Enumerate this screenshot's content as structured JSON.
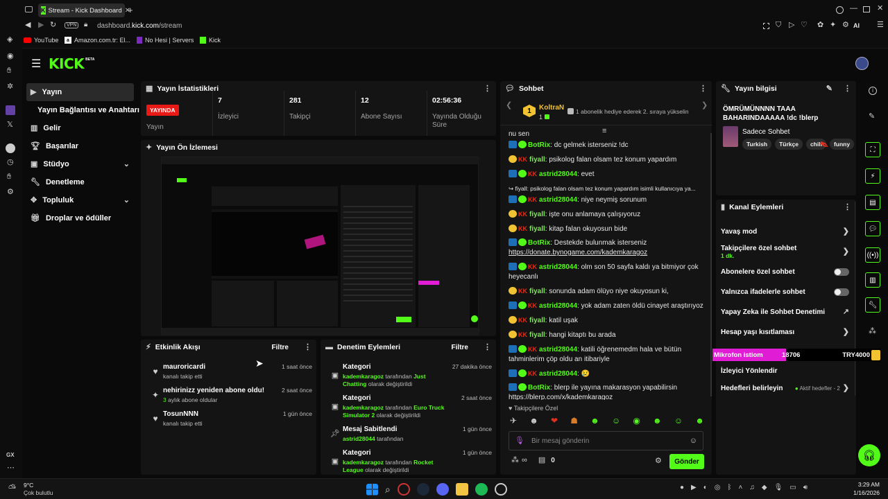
{
  "browser": {
    "tab_title": "Stream - Kick Dashboard",
    "url_prefix": "dashboard.",
    "url_domain": "kick.com",
    "url_path": "/stream",
    "vpn": "VPN",
    "ai": "AI",
    "bookmarks": [
      "YouTube",
      "Amazon.com.tr: El...",
      "No Hesi | Servers",
      "Kick"
    ],
    "gx": "GX"
  },
  "logo": {
    "text": "KICK",
    "beta": "BETA"
  },
  "nav": {
    "items": [
      {
        "label": "Yayın"
      },
      {
        "label": "Yayın Bağlantısı ve Anahtarı"
      },
      {
        "label": "Gelir"
      },
      {
        "label": "Başarılar"
      },
      {
        "label": "Stüdyo"
      },
      {
        "label": "Denetleme"
      },
      {
        "label": "Topluluk"
      },
      {
        "label": "Droplar ve ödüller"
      }
    ]
  },
  "stats": {
    "title": "Yayın İstatistikleri",
    "live_label": "YAYINDA",
    "live_sub": "Yayın",
    "viewers": {
      "value": "7",
      "label": "İzleyici"
    },
    "followers": {
      "value": "281",
      "label": "Takipçi"
    },
    "subs": {
      "value": "12",
      "label": "Abone Sayısı"
    },
    "uptime": {
      "value": "02:56:36",
      "label": "Yayında Olduğu Süre"
    }
  },
  "preview": {
    "title": "Yayın Ön İzlemesi"
  },
  "activity": {
    "title": "Etkinlik Akışı",
    "filter": "Filtre",
    "items": [
      {
        "title": "mauroricardi",
        "sub": "kanalı takip etti",
        "time": "1 saat önce"
      },
      {
        "title": "nehirinizz yeniden abone oldu!",
        "sub_highlight": "3",
        "sub": " aylık abone oldular",
        "time": "2 saat önce"
      },
      {
        "title": "TosunNNN",
        "sub": "kanalı takip etti",
        "time": "1 gün önce"
      }
    ]
  },
  "moderation": {
    "title": "Denetim Eylemleri",
    "filter": "Filtre",
    "items": [
      {
        "title": "Kategori",
        "user": "kademkaragoz",
        "mid": " tarafından ",
        "target": "Just Chatting",
        "tail": " olarak değiştirildi",
        "time": "27 dakika önce"
      },
      {
        "title": "Kategori",
        "user": "kademkaragoz",
        "mid": " tarafından ",
        "target": "Euro Truck Simulator 2",
        "tail": " olarak değiştirildi",
        "time": "2 saat önce"
      },
      {
        "title": "Mesaj Sabitlendi",
        "user": "astrid28044",
        "mid": " tarafından",
        "target": "",
        "tail": "",
        "time": "1 gün önce"
      },
      {
        "title": "Kategori",
        "user": "kademkaragoz",
        "mid": " tarafından ",
        "target": "Rocket League",
        "tail": " olarak değiştirildi",
        "time": "1 gün önce"
      }
    ]
  },
  "chat": {
    "title": "Sohbet",
    "gifter": "KoltraN",
    "gifter_count": "1",
    "gift_text": "1 abonelik hediye ederek 2. sıraya yükselin",
    "cut_line": "nu sen",
    "messages": [
      {
        "user": "BotRix",
        "type": "bot",
        "text": "dc gelmek isterseniz !dc"
      },
      {
        "user": "fiyall",
        "type": "sub",
        "text": "psikolog falan olsam tez konum yapardım"
      },
      {
        "user": "astrid28044",
        "type": "kk",
        "text": "evet"
      },
      {
        "user": "",
        "type": "reply",
        "text": "fiyall: psikolog falan olsam tez konum yapardım isimli kullanıcıya ya..."
      },
      {
        "user": "astrid28044",
        "type": "kk",
        "text": "niye neymiş sorunum"
      },
      {
        "user": "fiyall",
        "type": "sub",
        "text": "işte onu anlamaya çalışıyoruz"
      },
      {
        "user": "fiyall",
        "type": "sub",
        "text": "kitap falan okuyosun bide"
      },
      {
        "user": "BotRix",
        "type": "bot",
        "text": "Destekde bulunmak isterseniz",
        "link": "https://donate.bynogame.com/kademkaragoz"
      },
      {
        "user": "astrid28044",
        "type": "kk",
        "text": "olm son 50 sayfa kaldı ya bitmiyor çok heyecanlı"
      },
      {
        "user": "fiyall",
        "type": "sub",
        "text": "sonunda adam ölüyo niye okuyosun ki,"
      },
      {
        "user": "astrid28044",
        "type": "kk",
        "text": "yok adam zaten öldü cinayet araştırıyoz"
      },
      {
        "user": "fiyall",
        "type": "sub",
        "text": "katil uşak"
      },
      {
        "user": "fiyall",
        "type": "sub",
        "text": "hangi kitaptı bu arada"
      },
      {
        "user": "astrid28044",
        "type": "kk",
        "text": "katili öğrenemedm hala ve bütün tahminlerim çöp oldu an itibariyle"
      },
      {
        "user": "astrid28044",
        "type": "kk",
        "text": "😢"
      },
      {
        "user": "BotRix",
        "type": "bot",
        "text": "blerp ile yayına makarasyon yapabilirsin",
        "link": "https://blerp.com/x/kademkaragoz"
      }
    ],
    "followers_only": "Takipçilere Özel",
    "input_placeholder": "Bir mesaj gönderin",
    "points": "0",
    "send": "Gönder"
  },
  "info": {
    "title": "Yayın bilgisi",
    "stream_title": "ÖMRÜMÜNNNN TAAA BAHARINDAAAAA !dc !blerp",
    "category": "Sadece Sohbet",
    "tags": [
      "Turkish",
      "Türkçe",
      "chill",
      "funny"
    ]
  },
  "channel": {
    "title": "Kanal Eylemleri",
    "slow_mode": "Yavaş mod",
    "followers_chat": "Takipçilere özel sohbet",
    "followers_chat_sub": "1 dk.",
    "subs_chat": "Abonelere özel sohbet",
    "emotes_chat": "Yalnızca ifadelerle sohbet",
    "ai_mod": "Yapay Zeka ile Sohbet Denetimi",
    "age": "Hesap yaşı kısıtlaması",
    "viewer_mgmt": "İzleyici Yönlendir",
    "goals": "Hedefleri belirleyin",
    "goals_sub": "Aktif hedefler - 2"
  },
  "overlay": {
    "mic": "Mikrofon istiom",
    "amount": "18706",
    "try": "TRY4000"
  },
  "taskbar": {
    "temp": "9°C",
    "weather": "Çok bulutlu",
    "time": "3:29 AM",
    "date": "1/16/2026"
  },
  "colors": {
    "accent": "#53fc18",
    "live": "#e91916",
    "bg": "#0a0a0a",
    "panel": "#141414",
    "pink": "#e01cd5"
  }
}
